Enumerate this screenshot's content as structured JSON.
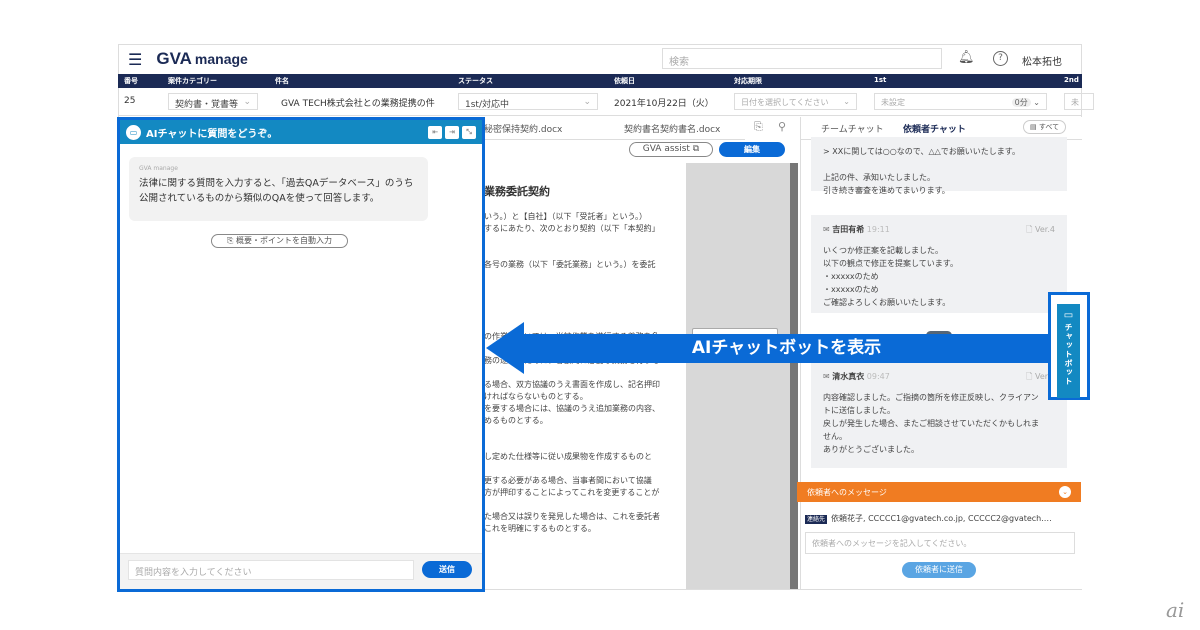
{
  "header": {
    "app": "GVA",
    "app_suffix": "manage",
    "search_placeholder": "検索",
    "user": "松本拓也"
  },
  "table": {
    "headers": [
      "番号",
      "案件カテゴリー",
      "件名",
      "ステータス",
      "依頼日",
      "対応期限",
      "1st",
      "2nd"
    ],
    "row": {
      "number": "25",
      "category": "契約書・覚書等",
      "title": "GVA TECH株式会社との業務提携の件",
      "status": "1st/対応中",
      "date": "2021年10月22日（火）",
      "deadline_placeholder": "日付を選択してください",
      "first": "未設定",
      "first_time": "0分",
      "second": "未"
    }
  },
  "ai_chat": {
    "title": "AIチャットに質問をどうぞ。",
    "sender": "GVA manage",
    "message": "法律に関する質問を入力すると、「過去QAデータベース」のうち公開されているものから類似のQAを使って回答します。",
    "auto_fill": "概要・ポイントを自動入力",
    "input_placeholder": "質問内容を入力してください",
    "send": "送信"
  },
  "document": {
    "tabs": [
      "秘密保持契約.docx",
      "契約書名契約書名.docx"
    ],
    "assist": "GVA assist",
    "edit": "編集",
    "heading": "業務委託契約",
    "lines": [
      "いう。）と【自社】（以下「受託者」という。）",
      "するにあたり、次のとおり契約（以下「本契約」",
      "",
      "",
      "各号の業務（以下「委託業務」という。）を委託",
      "",
      "",
      "",
      "",
      "",
      "の作業については、当該作業を遂行する義務を負",
      "",
      "務の遂行のために、客観的に必要な業務を行うも",
      "",
      "る場合、双方協議のうえ書面を作成し、記名押印",
      "ければならないものとする。",
      "を要する場合には、協議のうえ追加業務の内容、",
      "めるものとする。",
      "",
      "",
      "し定めた仕様等に従い成果物を作成するものと",
      "",
      "更する必要がある場合、当事者間において協議",
      "方が押印することによってこれを変更することが",
      "",
      "た場合又は誤りを発見した場合は、これを委託者",
      "これを明確にするものとする。"
    ]
  },
  "right_panel": {
    "tabs": [
      "チームチャット",
      "依頼者チャット"
    ],
    "filter": "すべて",
    "messages": [
      {
        "name": "",
        "time": "",
        "ver": "",
        "lines": [
          "> XXに関しては○○なので、△△でお願いいたします。",
          "",
          "上記の件、承知いたしました。",
          "引き続き審査を進めてまいります。"
        ]
      },
      {
        "name": "吉田有希",
        "time": "19:11",
        "ver": "Ver.4",
        "lines": [
          "いくつか修正案を記載しました。",
          "以下の観点で修正を提案しています。",
          "・xxxxxのため",
          "・xxxxxのため",
          "ご確認よろしくお願いいたします。"
        ]
      },
      {
        "name": "清水真衣",
        "time": "09:47",
        "ver": "Ver.4",
        "lines": [
          "内容確認しました。ご指摘の箇所を修正反映し、クライアン",
          "トに送信しました。",
          "戻しが発生した場合、またご相談させていただくかもしれま",
          "せん。",
          "ありがとうございました。"
        ]
      }
    ],
    "message_bar": "依頼者へのメッセージ",
    "contact_label": "連絡先",
    "contacts": "依頼花子, CCCCC1@gvatech.co.jp, CCCCC2@gvatech.…",
    "message_placeholder": "依頼者へのメッセージを記入してください。",
    "send": "依頼者に送信"
  },
  "chatbot_tab": "チャットボット",
  "callout": "AIチャットボットを表示",
  "colors": {
    "navy": "#1b2a55",
    "teal": "#1389c2",
    "blue": "#0a6ad6",
    "orange": "#f07c22"
  }
}
